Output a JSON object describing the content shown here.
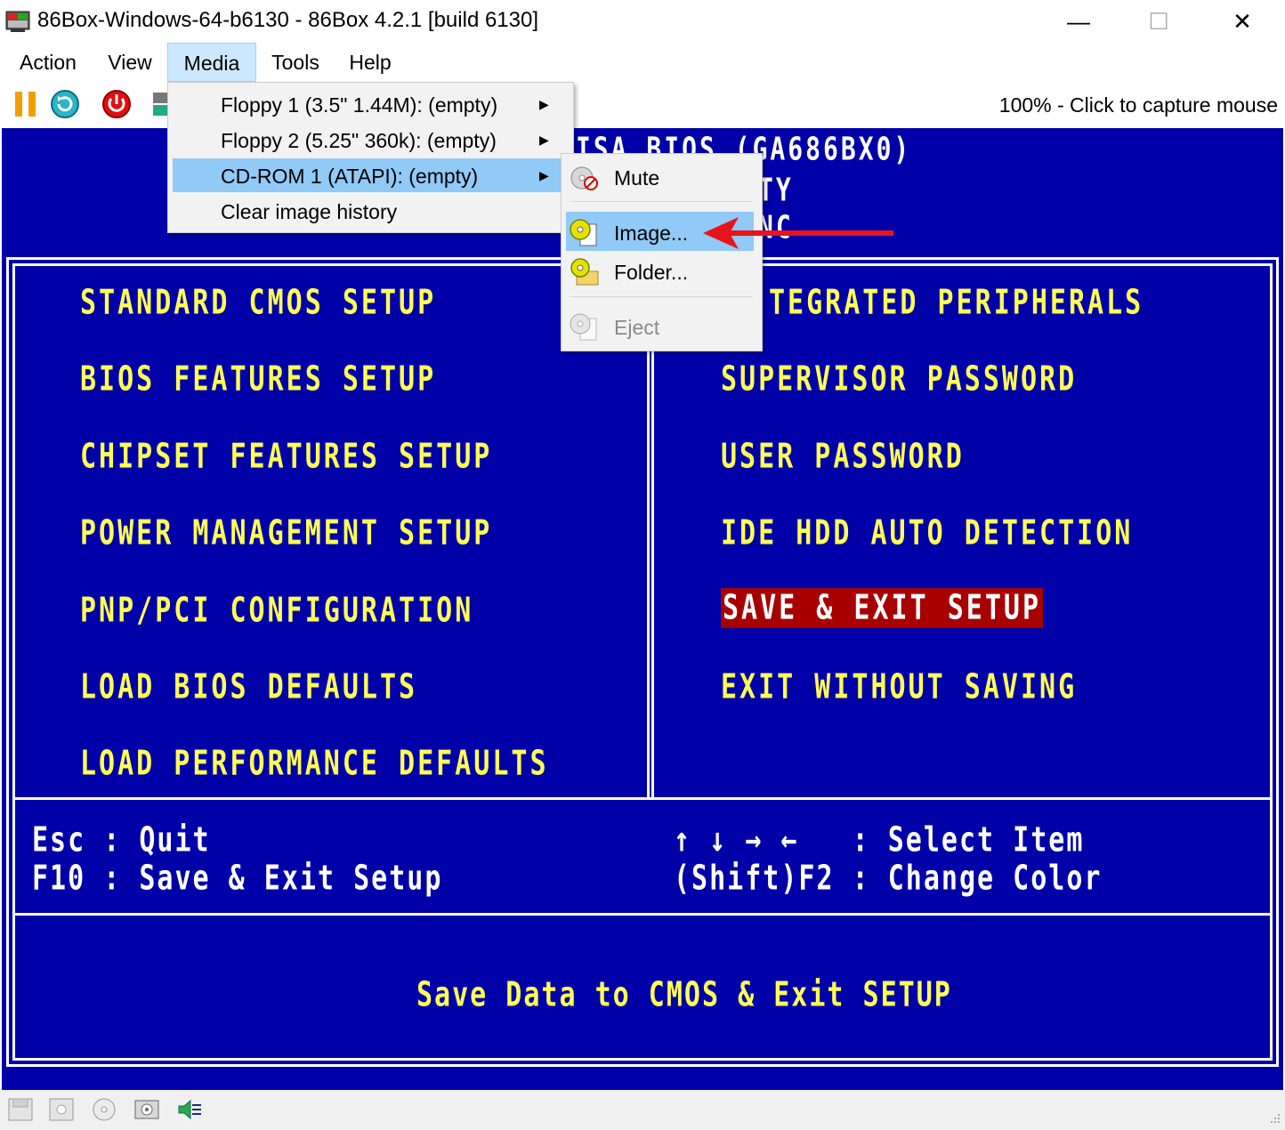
{
  "window": {
    "title": "86Box-Windows-64-b6130 - 86Box 4.2.1 [build 6130]",
    "minimize_glyph": "—",
    "maximize_glyph": "☐",
    "close_glyph": "✕"
  },
  "menubar": {
    "items": [
      "Action",
      "View",
      "Media",
      "Tools",
      "Help"
    ],
    "active": "Media"
  },
  "toolbar": {
    "icons": [
      "pause-icon",
      "reset-icon",
      "power-icon",
      "ctrl-alt-del-icon"
    ],
    "status": "100% - Click to capture mouse"
  },
  "media_menu": {
    "items": [
      {
        "label": "Floppy 1 (3.5\" 1.44M): (empty)",
        "has_submenu": true
      },
      {
        "label": "Floppy 2 (5.25\" 360k): (empty)",
        "has_submenu": true
      },
      {
        "label": "CD-ROM 1 (ATAPI): (empty)",
        "has_submenu": true,
        "highlighted": true
      },
      {
        "label": "Clear image history",
        "has_submenu": false
      }
    ]
  },
  "cdrom_submenu": {
    "items": [
      {
        "label": "Mute",
        "icon": "cd-mute-icon"
      },
      {
        "label": "Image...",
        "icon": "cd-image-icon",
        "highlighted": true
      },
      {
        "label": "Folder...",
        "icon": "cd-folder-icon"
      },
      {
        "label": "Eject",
        "icon": "cd-eject-icon",
        "disabled": true
      }
    ]
  },
  "annotation": {
    "arrow_color": "#e8141b"
  },
  "bios": {
    "header_fragments": [
      "ISA BIOS (GA686BX0)",
      "TY",
      "NC"
    ],
    "left_items": [
      "STANDARD CMOS SETUP",
      "BIOS FEATURES SETUP",
      "CHIPSET FEATURES SETUP",
      "POWER MANAGEMENT SETUP",
      "PNP/PCI CONFIGURATION",
      "LOAD BIOS DEFAULTS",
      "LOAD PERFORMANCE DEFAULTS"
    ],
    "right_items": [
      "TEGRATED PERIPHERALS",
      "SUPERVISOR PASSWORD",
      "USER PASSWORD",
      "IDE HDD AUTO DETECTION",
      "SAVE & EXIT SETUP",
      "EXIT WITHOUT SAVING"
    ],
    "selected": "SAVE & EXIT SETUP",
    "help_left": [
      "Esc : Quit",
      "F10 : Save & Exit Setup"
    ],
    "help_right": [
      "↑ ↓ → ←   : Select Item",
      "(Shift)F2 : Change Color"
    ],
    "description": "Save Data to CMOS & Exit SETUP",
    "colors": {
      "background": "#0000a8",
      "text": "#ffff54",
      "highlight": "#a80000"
    }
  },
  "statusbar": {
    "icons": [
      "floppy1-icon",
      "floppy2-icon",
      "cdrom-icon",
      "hdd-icon",
      "sound-icon"
    ]
  }
}
